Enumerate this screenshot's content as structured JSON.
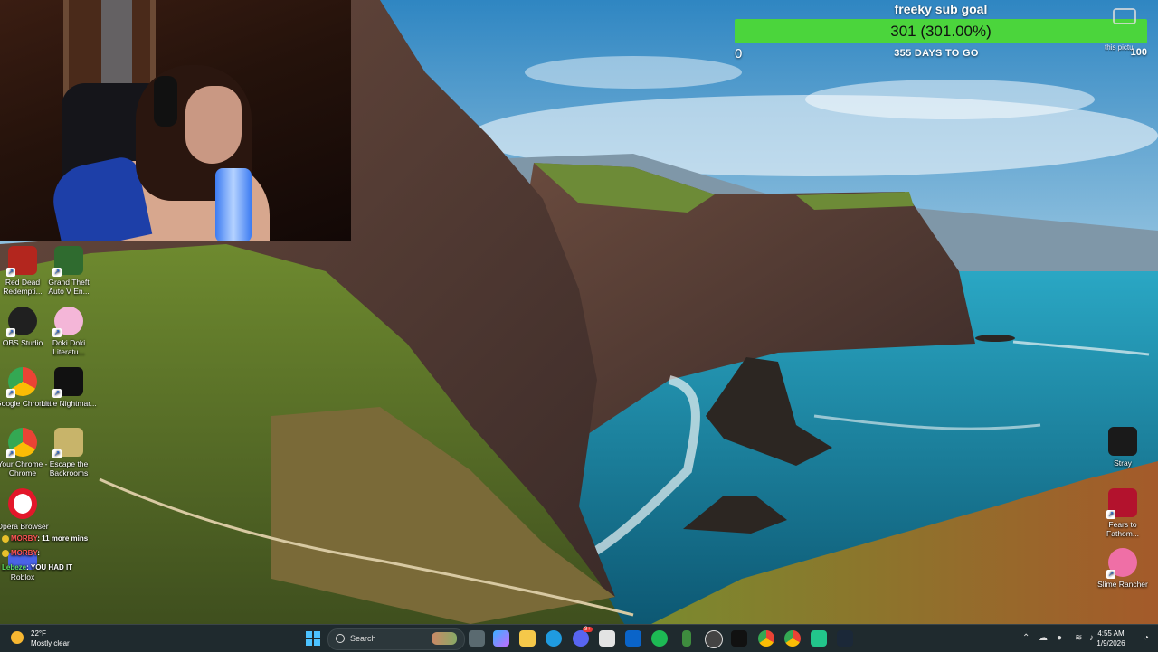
{
  "stream_overlay": {
    "goal": {
      "title": "freeky sub goal",
      "value_label": "301 (301.00%)",
      "progress_fraction": 1.0,
      "min_label": "0",
      "max_label": "100",
      "days_label": "355 DAYS TO GO",
      "fill_color": "#4bd53c"
    },
    "corner_text": "this pictu"
  },
  "desktop_icons": [
    {
      "label": "Red Dead Redempti...",
      "icon": "red-dead-icon",
      "color": "#b3261e"
    },
    {
      "label": "Grand Theft Auto V En...",
      "icon": "gta-v-icon",
      "color": "#2f6b2f"
    },
    {
      "label": "OBS Studio",
      "icon": "obs-icon",
      "color": "#202020"
    },
    {
      "label": "Doki Doki Literatu...",
      "icon": "doki-doki-icon",
      "color": "#f4b6d8"
    },
    {
      "label": "Google Chrome",
      "icon": "chrome-icon",
      "color": "#ea4335"
    },
    {
      "label": "Little Nightmar...",
      "icon": "little-nightmares-icon",
      "color": "#111111"
    },
    {
      "label": "Your Chrome - Chrome",
      "icon": "chrome-profile-icon",
      "color": "#34a853"
    },
    {
      "label": "Escape the Backrooms",
      "icon": "backrooms-icon",
      "color": "#c8b46a"
    },
    {
      "label": "Opera Browser",
      "icon": "opera-icon",
      "color": "#e3172a"
    },
    {
      "label": "Roblox",
      "icon": "roblox-icon",
      "color": "#4a63e7"
    },
    {
      "label": "Stray",
      "icon": "stray-icon",
      "color": "#1a1a1a"
    },
    {
      "label": "Fears to Fathom...",
      "icon": "fears-to-fathom-icon",
      "color": "#b3122d"
    },
    {
      "label": "Slime Rancher",
      "icon": "slime-rancher-icon",
      "color": "#ef6fa6"
    }
  ],
  "chat": [
    {
      "user": "MORBY",
      "message": ": 11 more mins"
    },
    {
      "user": "MORBY",
      "message": ": "
    },
    {
      "user": "Lebeze",
      "message": ": YOU HAD IT"
    }
  ],
  "taskbar": {
    "weather_temp": "22°F",
    "weather_desc": "Mostly clear",
    "search_label": "Search",
    "time": "4:55 AM",
    "date": "1/9/2026",
    "discord_badge": "9+",
    "pinned": [
      "file-explorer-icon",
      "copilot-icon",
      "edge-icon",
      "discord-icon",
      "store-icon",
      "outlook-icon",
      "spotify-icon",
      "game-icon",
      "obs-icon",
      "tiktok-icon",
      "chrome-icon",
      "chrome-icon",
      "app-icon",
      "steam-icon"
    ]
  }
}
